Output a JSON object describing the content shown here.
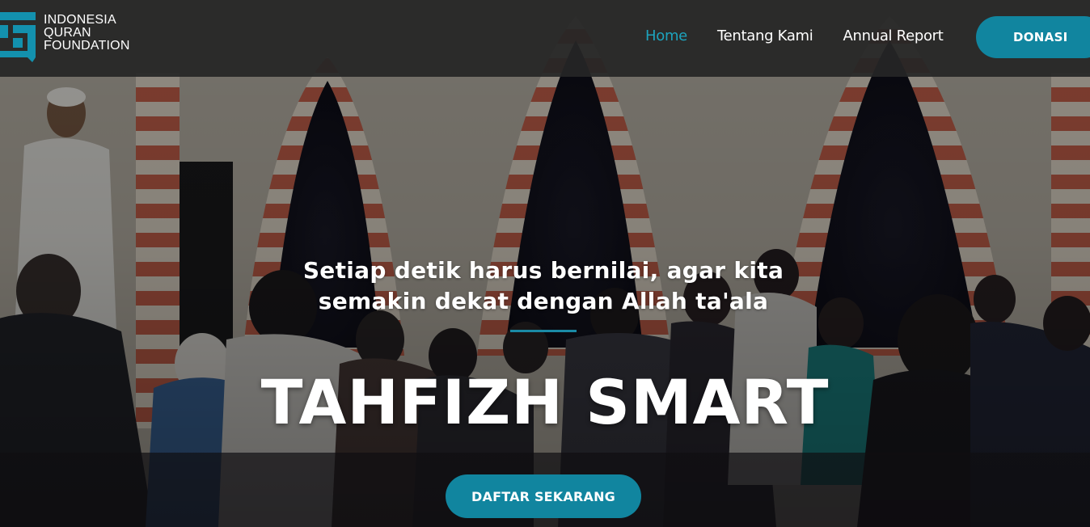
{
  "brand": {
    "name_lines": [
      "INDONESIA",
      "QURAN",
      "FOUNDATION"
    ],
    "logo_icon": "iqf-logo-icon",
    "logo_color": "#1391ae"
  },
  "nav": {
    "items": [
      {
        "label": "Home",
        "active": true
      },
      {
        "label": "Tentang Kami",
        "active": false
      },
      {
        "label": "Annual Report",
        "active": false
      }
    ],
    "donate_label": "DONASI"
  },
  "hero": {
    "tagline": "Setiap detik harus bernilai, agar kita semakin dekat dengan Allah ta'ala",
    "title": "TAHFIZH SMART",
    "cta_label": "DAFTAR SEKARANG"
  },
  "colors": {
    "accent": "#11859f",
    "active_link": "#1da3bd",
    "header_bg": "#262626"
  }
}
